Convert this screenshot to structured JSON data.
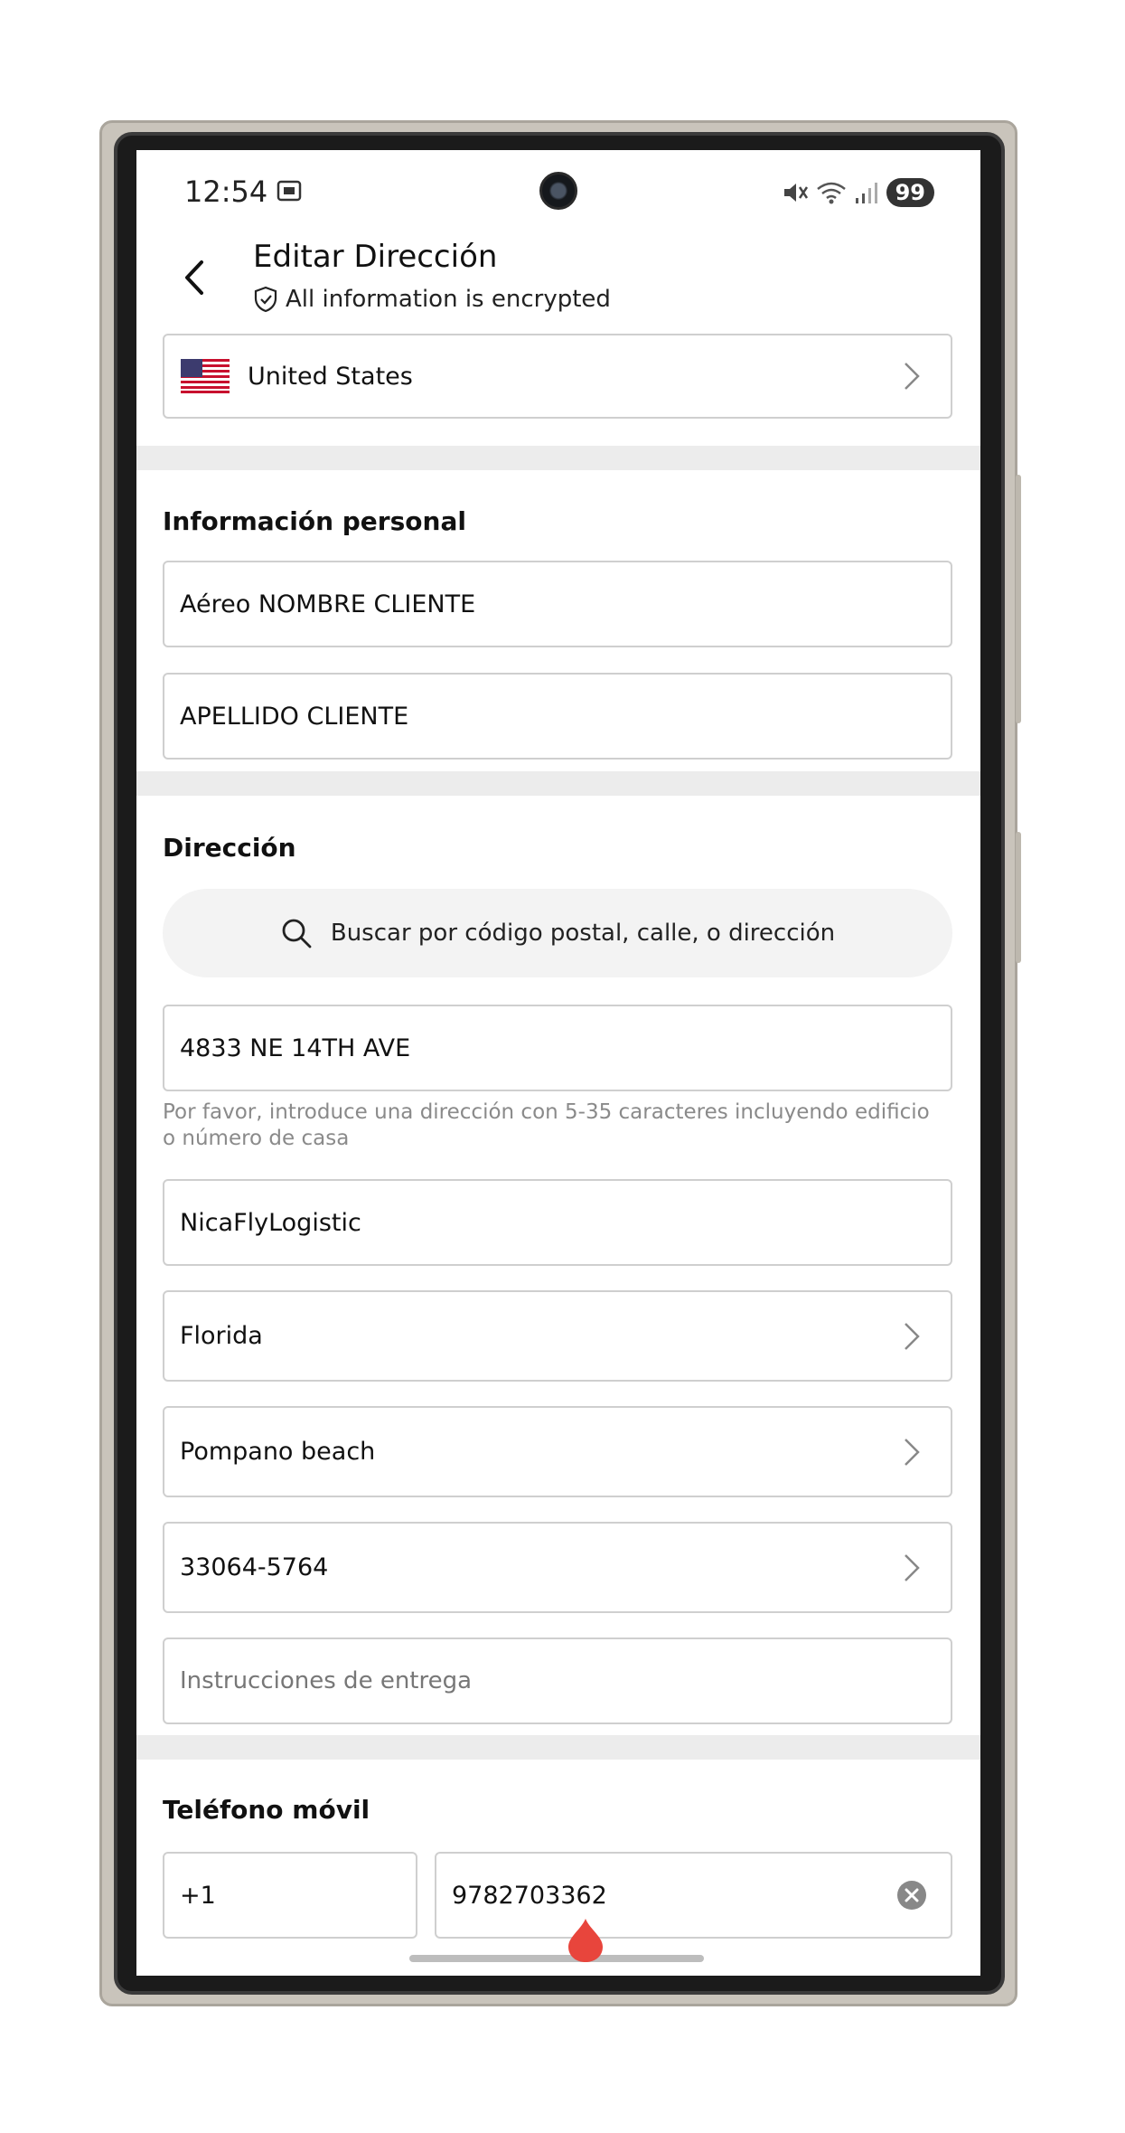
{
  "status": {
    "time": "12:54",
    "battery": "99"
  },
  "header": {
    "title": "Editar Dirección",
    "subtitle": "All information is encrypted"
  },
  "country": {
    "name": "United States"
  },
  "personal": {
    "section_title": "Información personal",
    "first_name": "Aéreo NOMBRE CLIENTE",
    "last_name": "APELLIDO CLIENTE"
  },
  "address": {
    "section_title": "Dirección",
    "search_placeholder": "Buscar por código postal, calle, o dirección",
    "street": "4833 NE 14TH AVE",
    "street_hint": "Por favor, introduce una dirección con 5-35 caracteres incluyendo edificio o número de casa",
    "line2": "NicaFlyLogistic",
    "state": "Florida",
    "city": "Pompano beach",
    "zip": "33064-5764",
    "instructions_placeholder": "Instrucciones de entrega"
  },
  "phone": {
    "section_title": "Teléfono móvil",
    "country_code": "+1",
    "number": "9782703362"
  },
  "colors": {
    "accent_red": "#e8453c",
    "divider": "#ececec",
    "border": "#cfcfcf"
  }
}
